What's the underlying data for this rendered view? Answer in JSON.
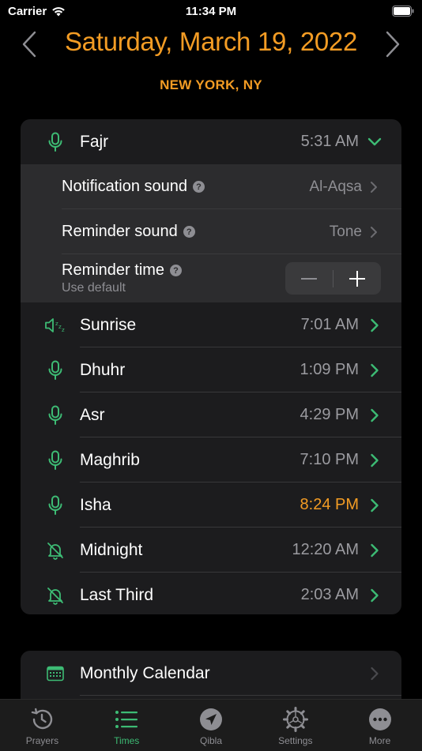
{
  "status_bar": {
    "carrier": "Carrier",
    "time": "11:34 PM"
  },
  "header": {
    "date": "Saturday, March 19, 2022",
    "location": "NEW YORK, NY"
  },
  "prayers": [
    {
      "name": "Fajr",
      "time": "5:31 AM",
      "icon": "microphone-icon",
      "expanded": true
    },
    {
      "name": "Sunrise",
      "time": "7:01 AM",
      "icon": "speaker-muted-icon"
    },
    {
      "name": "Dhuhr",
      "time": "1:09 PM",
      "icon": "microphone-icon"
    },
    {
      "name": "Asr",
      "time": "4:29 PM",
      "icon": "microphone-icon"
    },
    {
      "name": "Maghrib",
      "time": "7:10 PM",
      "icon": "microphone-icon"
    },
    {
      "name": "Isha",
      "time": "8:24 PM",
      "icon": "microphone-icon",
      "current": true
    },
    {
      "name": "Midnight",
      "time": "12:20 AM",
      "icon": "bell-slash-icon"
    },
    {
      "name": "Last Third",
      "time": "2:03 AM",
      "icon": "bell-slash-icon"
    }
  ],
  "fajr_settings": {
    "notification_sound": {
      "label": "Notification sound",
      "value": "Al-Aqsa"
    },
    "reminder_sound": {
      "label": "Reminder sound",
      "value": "Tone"
    },
    "reminder_time": {
      "label": "Reminder time",
      "hint": "Use default"
    }
  },
  "extras": {
    "monthly_calendar": "Monthly Calendar"
  },
  "tabs": [
    {
      "label": "Prayers",
      "icon": "history-clock-icon"
    },
    {
      "label": "Times",
      "icon": "list-icon",
      "selected": true
    },
    {
      "label": "Qibla",
      "icon": "compass-arrow-icon"
    },
    {
      "label": "Settings",
      "icon": "gear-icon"
    },
    {
      "label": "More",
      "icon": "more-dots-icon"
    }
  ],
  "colors": {
    "accent_orange": "#F39C24",
    "accent_green": "#3DBB74",
    "card": "#1C1C1E",
    "secondary_text": "#9B9BA0"
  }
}
